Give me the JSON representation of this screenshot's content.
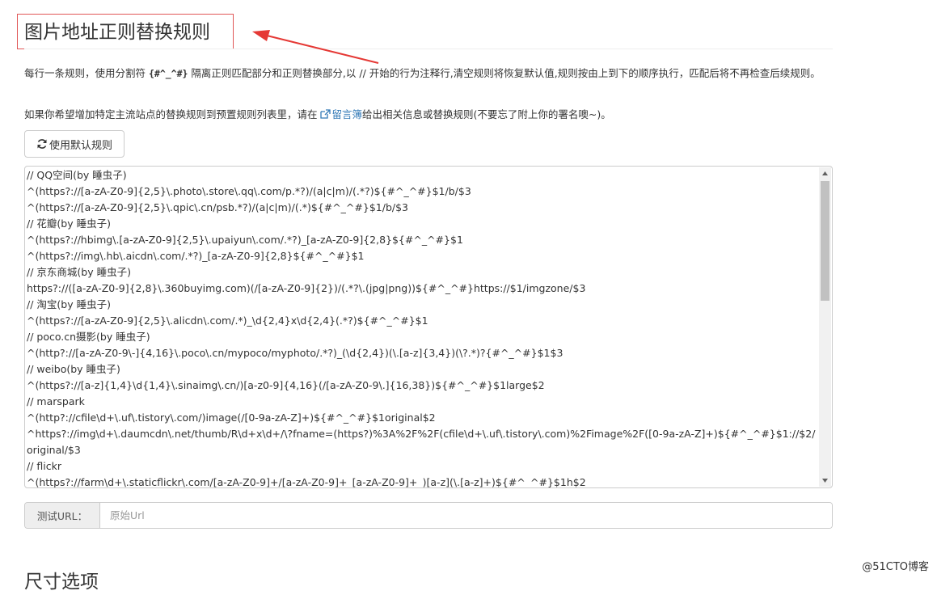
{
  "header": {
    "title": "图片地址正则替换规则"
  },
  "description": {
    "part1": "每行一条规则，使用分割符 ",
    "separator": "{#^_^#}",
    "part2": " 隔离正则匹配部分和正则替换部分,以 // 开始的行为注释行,清空规则将恢复默认值,规则按由上到下的顺序执行，匹配后将不再检查后续规则。",
    "line2_before": "如果你希望增加特定主流站点的替换规则到预置规则列表里，请在 ",
    "guestbook_link": "留言簿",
    "line2_after": "给出相关信息或替换规则(不要忘了附上你的署名噢~)。"
  },
  "buttons": {
    "use_default": "使用默认规则"
  },
  "rules": [
    "// QQ空间(by 睡虫子)",
    "^(https?://[a-zA-Z0-9]{2,5}\\.photo\\.store\\.qq\\.com/p.*?)/(a|c|m)/(.*?)${#^_^#}$1/b/$3",
    "^(https?://[a-zA-Z0-9]{2,5}\\.qpic\\.cn/psb.*?)/(a|c|m)/(.*)${#^_^#}$1/b/$3",
    "// 花瓣(by 睡虫子)",
    "^(https?://hbimg\\.[a-zA-Z0-9]{2,5}\\.upaiyun\\.com/.*?)_[a-zA-Z0-9]{2,8}${#^_^#}$1",
    "^(https?://img\\.hb\\.aicdn\\.com/.*?)_[a-zA-Z0-9]{2,8}${#^_^#}$1",
    "// 京东商城(by 睡虫子)",
    "https?://([a-zA-Z0-9]{2,8}\\.360buyimg.com)(/[a-zA-Z0-9]{2})/(.*?\\.(jpg|png))${#^_^#}https://$1/imgzone/$3",
    "// 淘宝(by 睡虫子)",
    "^(https?://[a-zA-Z0-9]{2,5}\\.alicdn\\.com/.*)_\\d{2,4}x\\d{2,4}(.*?)${#^_^#}$1",
    "// poco.cn摄影(by 睡虫子)",
    "^(http?://[a-zA-Z0-9\\-]{4,16}\\.poco\\.cn/mypoco/myphoto/.*?)_(\\d{2,4})(\\.[a-z]{3,4})(\\?.*)?{#^_^#}$1$3",
    "// weibo(by 睡虫子)",
    "^(https?://[a-z]{1,4}\\d{1,4}\\.sinaimg\\.cn/)[a-z0-9]{4,16}(/[a-zA-Z0-9\\.]{16,38})${#^_^#}$1large$2",
    "// marspark",
    "^(http?://cfile\\d+\\.uf\\.tistory\\.com/)image(/[0-9a-zA-Z]+)${#^_^#}$1original$2",
    "^https?://img\\d+\\.daumcdn\\.net/thumb/R\\d+x\\d+/\\?fname=(https?)%3A%2F%2F(cfile\\d+\\.uf\\.tistory\\.com)%2Fimage%2F([0-9a-zA-Z]+)${#^_^#}$1://$2/original/$3",
    "// flickr",
    "^(https?://farm\\d+\\.staticflickr\\.com/[a-zA-Z0-9]+/[a-zA-Z0-9]+_[a-zA-Z0-9]+_)[a-z](\\.[a-z]+)${#^_^#}$1h$2"
  ],
  "test_url": {
    "label": "测试URL：",
    "placeholder": "原始Url",
    "value": ""
  },
  "next_section_title": "尺寸选项",
  "watermark": "@51CTO博客",
  "colors": {
    "highlight_box": "#e05757",
    "link": "#337ab7",
    "arrow": "#e53935"
  },
  "icons": {
    "refresh": "refresh-icon",
    "external_link": "external-link-icon",
    "arrow": "annotation-arrow"
  }
}
